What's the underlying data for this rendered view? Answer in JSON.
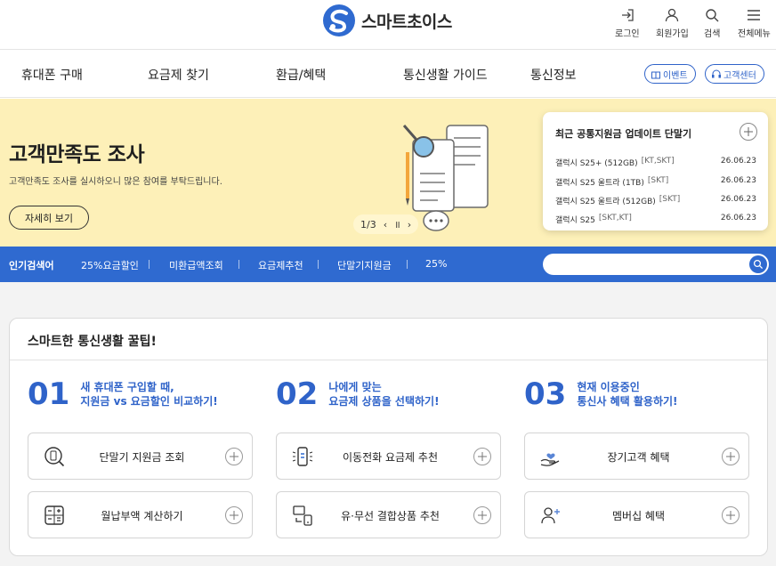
{
  "brand": {
    "name": "스마트초이스",
    "accent": "#2f6ad0"
  },
  "utils": [
    {
      "label": "로그인",
      "icon": "login-icon"
    },
    {
      "label": "회원가입",
      "icon": "user-icon"
    },
    {
      "label": "검색",
      "icon": "search-icon"
    },
    {
      "label": "전체메뉴",
      "icon": "menu-icon"
    }
  ],
  "nav": {
    "items": [
      "휴대폰 구매",
      "요금제 찾기",
      "환급/혜택",
      "통신생활 가이드",
      "통신정보"
    ],
    "event_label": "이벤트",
    "support_label": "고객센터"
  },
  "banner": {
    "title": "고객만족도 조사",
    "subtitle": "고객만족도 조사를 실시하오니 많은 참여를 부탁드립니다.",
    "button": "자세히 보기",
    "pager": {
      "current": "1/3",
      "prev": "‹",
      "pause": "॥",
      "next": "›"
    }
  },
  "update_card": {
    "title": "최근 공통지원금 업데이트 단말기",
    "rows": [
      {
        "model": "갤럭시 S25+ (512GB)",
        "carrier": "[KT,SKT]",
        "date": "26.06.23"
      },
      {
        "model": "갤럭시 S25 울트라 (1TB)",
        "carrier": "[SKT]",
        "date": "26.06.23"
      },
      {
        "model": "갤럭시 S25 울트라 (512GB)",
        "carrier": "[SKT]",
        "date": "26.06.23"
      },
      {
        "model": "갤럭시 S25",
        "carrier": "[SKT,KT]",
        "date": "26.06.23"
      }
    ]
  },
  "popular": {
    "label": "인기검색어",
    "keywords": [
      "25%요금할인",
      "미환급액조회",
      "요금제추천",
      "단말기지원금",
      "25%"
    ],
    "search_placeholder": ""
  },
  "tips": {
    "title": "스마트한 통신생활 꿀팁!",
    "steps": [
      {
        "num": "01",
        "line1": "새 휴대폰 구입할 때,",
        "line2": "지원금 vs 요금할인 비교하기!"
      },
      {
        "num": "02",
        "line1": "나에게 맞는",
        "line2": "요금제 상품을 선택하기!"
      },
      {
        "num": "03",
        "line1": "현재 이용중인",
        "line2": "통신사 혜택 활용하기!"
      }
    ],
    "buttons": [
      {
        "label": "단말기 지원금 조회",
        "icon": "phone-search-icon"
      },
      {
        "label": "이동전화 요금제 추천",
        "icon": "phone-recommend-icon"
      },
      {
        "label": "장기고객 혜택",
        "icon": "heart-hand-icon"
      },
      {
        "label": "월납부액 계산하기",
        "icon": "calculator-icon"
      },
      {
        "label": "유·무선 결합상품 추천",
        "icon": "bundle-icon"
      },
      {
        "label": "멤버십 혜택",
        "icon": "membership-icon"
      }
    ]
  }
}
